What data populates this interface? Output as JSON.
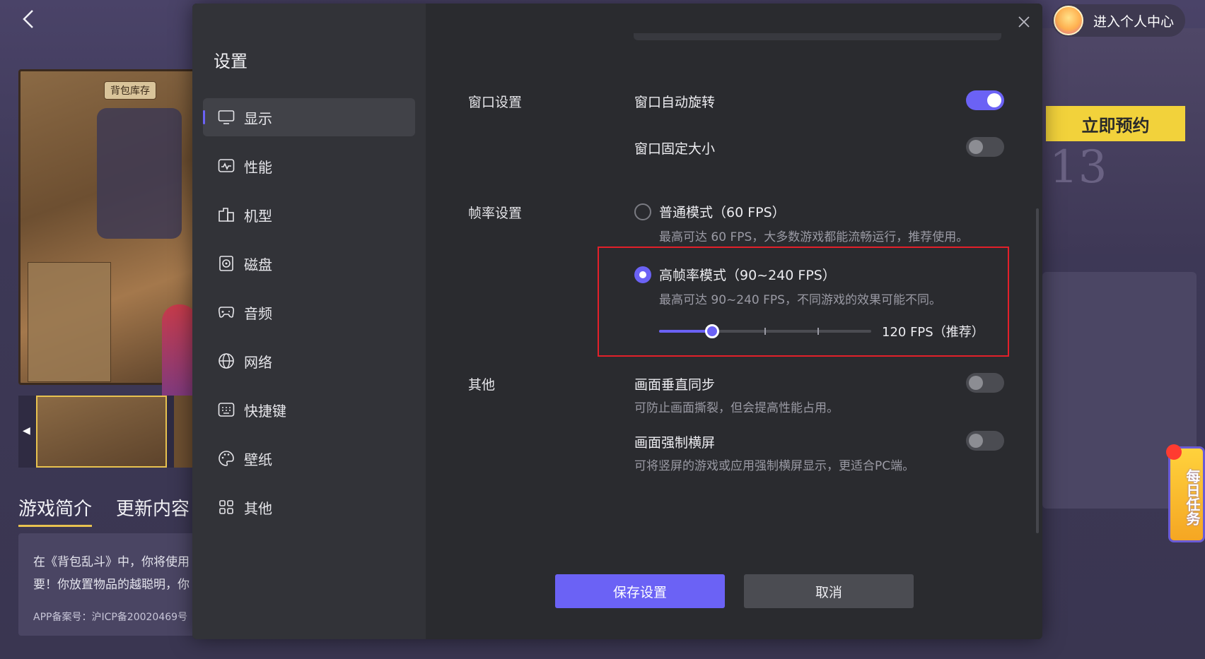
{
  "background": {
    "back_icon": "chevron-left-icon",
    "game_screenshot_tag": "背包库存",
    "tabs": [
      "游戏简介",
      "更新内容"
    ],
    "intro_lines": [
      "在《背包乱斗》中，你将使用",
      "要！你放置物品的越聪明，你"
    ],
    "icp": "APP备案号：沪ICP备20020469号",
    "profile_label": "进入个人中心",
    "reserve_label": "立即预约",
    "deco_number": "13",
    "daily_task_label": "每日任务"
  },
  "dialog": {
    "title": "设置",
    "close_icon": "close-icon",
    "nav": [
      {
        "label": "显示",
        "icon": "monitor-icon",
        "active": true
      },
      {
        "label": "性能",
        "icon": "pulse-icon",
        "active": false
      },
      {
        "label": "机型",
        "icon": "device-icon",
        "active": false
      },
      {
        "label": "磁盘",
        "icon": "disk-icon",
        "active": false
      },
      {
        "label": "音频",
        "icon": "gamepad-icon",
        "active": false
      },
      {
        "label": "网络",
        "icon": "globe-icon",
        "active": false
      },
      {
        "label": "快捷键",
        "icon": "keyboard-icon",
        "active": false
      },
      {
        "label": "壁纸",
        "icon": "palette-icon",
        "active": false
      },
      {
        "label": "其他",
        "icon": "grid-icon",
        "active": false
      }
    ],
    "window_section": {
      "label": "窗口设置",
      "auto_rotate": {
        "label": "窗口自动旋转",
        "on": true
      },
      "fixed_size": {
        "label": "窗口固定大小",
        "on": false
      }
    },
    "fps_section": {
      "label": "帧率设置",
      "normal": {
        "label": "普通模式（60 FPS）",
        "desc": "最高可达 60 FPS，大多数游戏都能流畅运行，推荐使用。",
        "checked": false
      },
      "high": {
        "label": "高帧率模式（90~240 FPS）",
        "desc": "最高可达 90~240 FPS，不同游戏的效果可能不同。",
        "checked": true
      },
      "slider": {
        "value_label": "120 FPS（推荐）",
        "position_fraction": 0.25
      }
    },
    "other_section": {
      "label": "其他",
      "vsync": {
        "label": "画面垂直同步",
        "desc": "可防止画面撕裂，但会提高性能占用。",
        "on": false
      },
      "force_landscape": {
        "label": "画面强制横屏",
        "desc": "可将竖屏的游戏或应用强制横屏显示，更适合PC端。",
        "on": false
      }
    },
    "save_label": "保存设置",
    "cancel_label": "取消"
  },
  "colors": {
    "accent": "#6b62f5",
    "highlight_border": "#e3202a",
    "reserve_button": "#f2d23b"
  }
}
